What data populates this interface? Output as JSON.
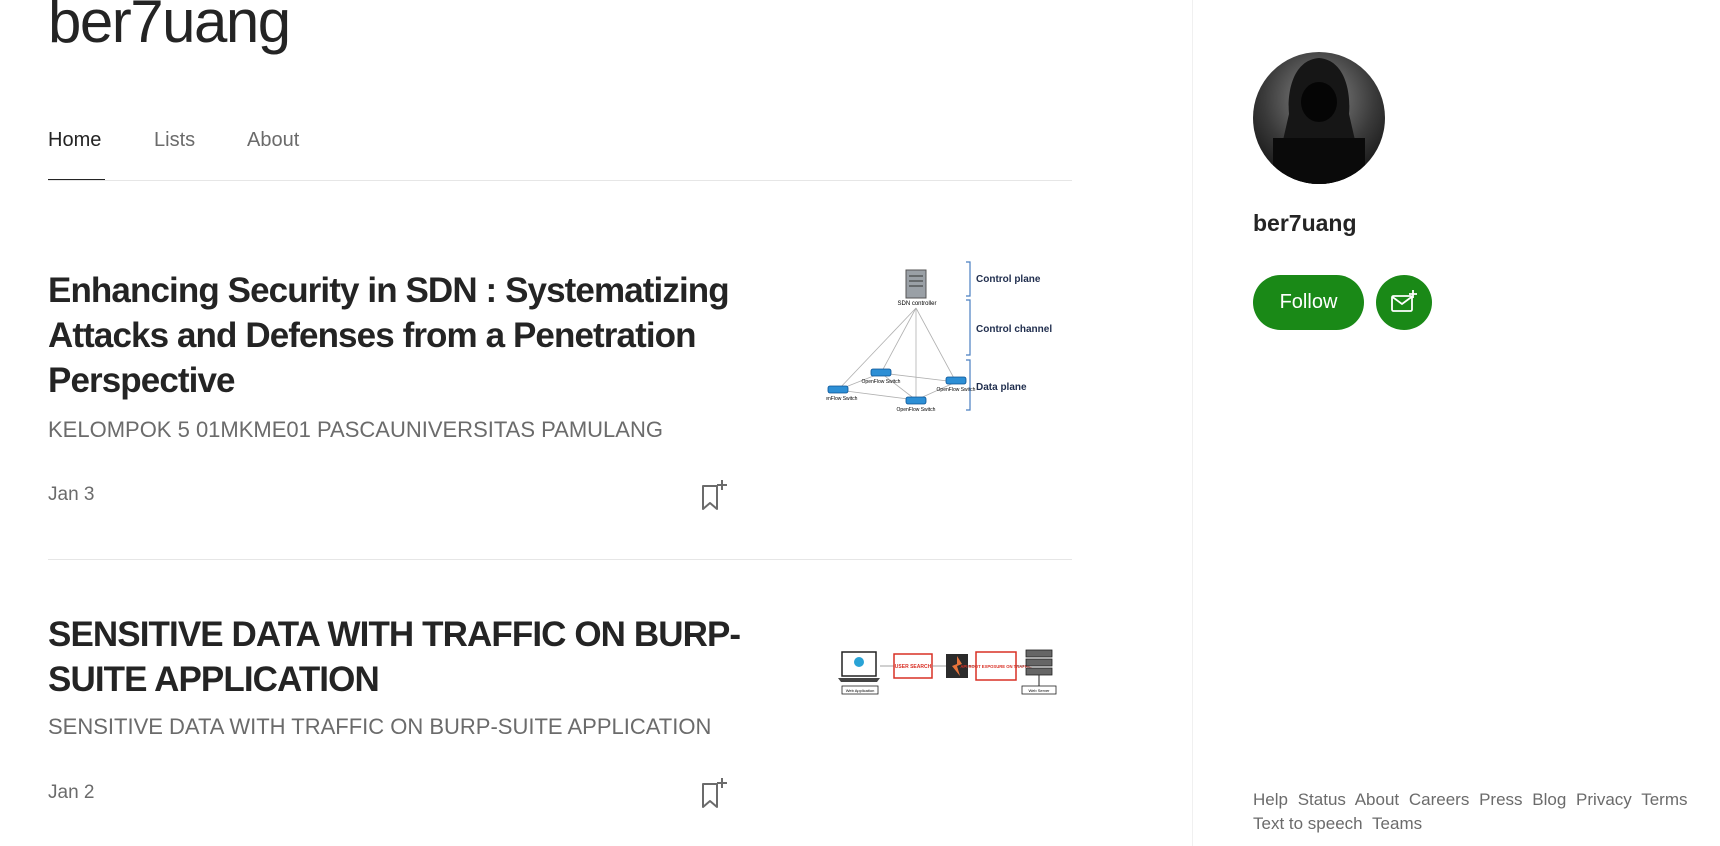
{
  "site": {
    "title": "ber7uang"
  },
  "tabs": [
    {
      "label": "Home",
      "active": true
    },
    {
      "label": "Lists",
      "active": false
    },
    {
      "label": "About",
      "active": false
    }
  ],
  "articles": [
    {
      "title": "Enhancing Security in SDN : Systematizing Attacks and Defenses from a Penetration Perspective",
      "subtitle": "KELOMPOK 5 01MKME01 PASCAUNIVERSITAS PAMULANG",
      "date": "Jan 3",
      "thumbnail": {
        "controller_label": "SDN controller",
        "switch_label": "OpenFlow Switch",
        "plane_labels": [
          "Control plane",
          "Control channel",
          "Data plane"
        ]
      }
    },
    {
      "title": "SENSITIVE DATA WITH TRAFFIC ON BURP-SUITE APPLICATION",
      "subtitle": "SENSITIVE DATA WITH TRAFFIC ON BURP-SUITE APPLICATION",
      "date": "Jan 2",
      "thumbnail": {
        "labels": [
          "USER SEARCH",
          "API ROOT EXPOSURE ON TRAFFIC"
        ],
        "captions": [
          "Web Application",
          "Web Server"
        ]
      }
    }
  ],
  "sidebar": {
    "profile_name": "ber7uang",
    "follow_label": "Follow",
    "subscribe_icon": "mail-plus-icon"
  },
  "footer": {
    "links": [
      "Help",
      "Status",
      "About",
      "Careers",
      "Press",
      "Blog",
      "Privacy",
      "Terms",
      "Text to speech",
      "Teams"
    ]
  },
  "colors": {
    "accent": "#1a8917",
    "text_primary": "#242424",
    "text_secondary": "#6b6b6b",
    "divider": "#e6e6e6"
  }
}
